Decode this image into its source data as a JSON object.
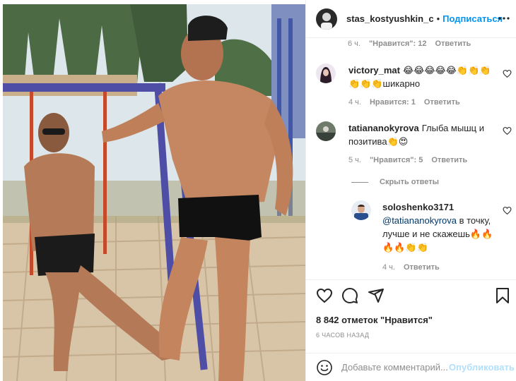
{
  "header": {
    "username": "stas_kostyushkin_c",
    "separator": "•",
    "follow_label": "Подписаться",
    "more_icon": "more-horizontal-icon"
  },
  "comments": [
    {
      "username": "",
      "text": "",
      "meta": {
        "age": "6 ч.",
        "likes": "\"Нравится\": 12",
        "reply": "Ответить"
      }
    },
    {
      "username": "victory_mat",
      "text": "😂😂😂😂😂👏👏👏👏👏👏шикарно",
      "meta": {
        "age": "4 ч.",
        "likes": "Нравится: 1",
        "reply": "Ответить"
      }
    },
    {
      "username": "tatiananokyrova",
      "text": "Глыба мышц и позитива👏😍",
      "meta": {
        "age": "5 ч.",
        "likes": "\"Нравится\": 5",
        "reply": "Ответить"
      }
    }
  ],
  "replies_toggle": "Скрыть ответы",
  "reply": {
    "username": "soloshenko3171",
    "mention": "@tatiananokyrova",
    "text": " в точку, лучше и не скажешь🔥🔥🔥🔥👏👏",
    "meta": {
      "age": "4 ч.",
      "reply": "Ответить"
    }
  },
  "actions": {
    "like_icon": "heart-icon",
    "comment_icon": "comment-icon",
    "share_icon": "share-icon",
    "save_icon": "bookmark-icon"
  },
  "likes_count": "8 842 отметок \"Нравится\"",
  "time_posted": "6 ЧАСОВ НАЗАД",
  "add_comment": {
    "placeholder": "Добавьте комментарий...",
    "publish_label": "Опубликовать"
  },
  "colors": {
    "accent": "#0095f6",
    "publish_disabled": "#b2dffc",
    "meta_text": "#8e8e8e"
  }
}
